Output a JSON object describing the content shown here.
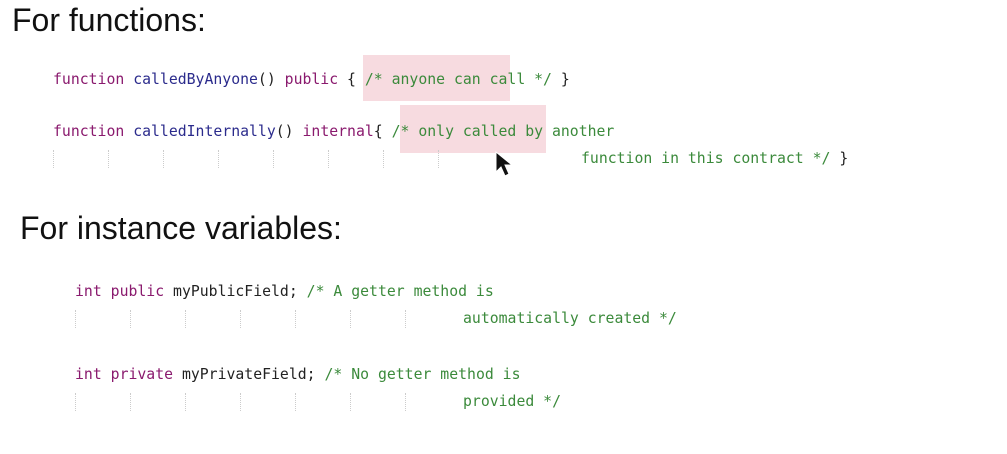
{
  "headings": {
    "functions": "For functions:",
    "variables": "For instance variables:"
  },
  "code": {
    "f1": {
      "kw": "function",
      "name": "calledByAnyone",
      "paren": "()",
      "mod": "public",
      "brace": "{",
      "comment": "/* anyone can call */",
      "close": "}"
    },
    "f2": {
      "kw": "function",
      "name": "calledInternally",
      "paren": "()",
      "mod": "internal",
      "brace": "{",
      "comment1": "/* only called by another",
      "comment2": "function in this contract */",
      "close": "}"
    },
    "v1": {
      "type": "int",
      "mod": "public",
      "name": "myPublicField;",
      "comment1": "/* A getter method is",
      "comment2": "automatically created */"
    },
    "v2": {
      "type": "int",
      "mod": "private",
      "name": "myPrivateField;",
      "comment1": "/* No getter method is",
      "comment2": "provided */"
    }
  }
}
